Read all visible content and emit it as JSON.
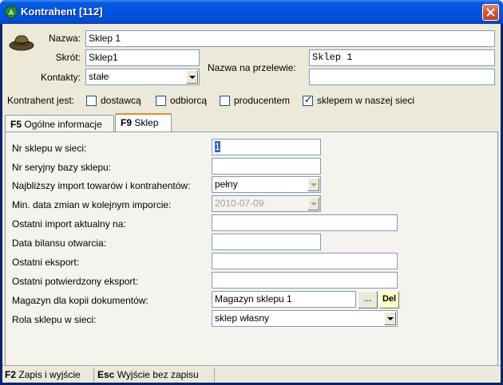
{
  "window": {
    "title": "Kontrahent [112]",
    "close_icon": "close-icon"
  },
  "header": {
    "nazwa_label": "Nazwa:",
    "nazwa_value": "Sklep 1",
    "skrot_label": "Skrót:",
    "skrot_value": "Sklep1",
    "kontakty_label": "Kontakty:",
    "kontakty_value": "stałe",
    "przelew_label": "Nazwa na przelewie:",
    "przelew_line1": "Sklep 1",
    "przelew_line2": ""
  },
  "kontrahent_type": {
    "label": "Kontrahent jest:",
    "options": [
      {
        "label": "dostawcą",
        "checked": false
      },
      {
        "label": "odbiorcą",
        "checked": false
      },
      {
        "label": "producentem",
        "checked": false
      },
      {
        "label": "sklepem w naszej sieci",
        "checked": true
      }
    ]
  },
  "tabs": [
    {
      "key": "F5",
      "label": "Ogólne informacje",
      "active": false
    },
    {
      "key": "F9",
      "label": "Sklep",
      "active": true
    }
  ],
  "form": {
    "nr_sklepu_label": "Nr sklepu w sieci:",
    "nr_sklepu_value": "1",
    "nr_seryjny_label": "Nr seryjny bazy sklepu:",
    "nr_seryjny_value": "",
    "import_label": "Najbliższy import towarów i kontrahentów:",
    "import_value": "pełny",
    "min_data_label": "Min. data zmian w kolejnym imporcie:",
    "min_data_value": "2010-07-09",
    "ostatni_import_label": "Ostatni import aktualny na:",
    "ostatni_import_value": "",
    "data_bilansu_label": "Data bilansu otwarcia:",
    "data_bilansu_value": "",
    "ostatni_eksport_label": "Ostatni eksport:",
    "ostatni_eksport_value": "",
    "potwierdzony_label": "Ostatni potwierdzony eksport:",
    "potwierdzony_value": "",
    "magazyn_label": "Magazyn dla kopii dokumentów:",
    "magazyn_value": "Magazyn sklepu 1",
    "magazyn_browse": "...",
    "magazyn_del": "Del",
    "rola_label": "Rola sklepu w sieci:",
    "rola_value": "sklep własny"
  },
  "status": {
    "f2_key": "F2",
    "f2_label": "Zapis i wyjście",
    "esc_key": "Esc",
    "esc_label": "Wyjście bez zapisu"
  },
  "colors": {
    "titlebar": "#0054e3",
    "tab_accent": "#e68b2c"
  }
}
